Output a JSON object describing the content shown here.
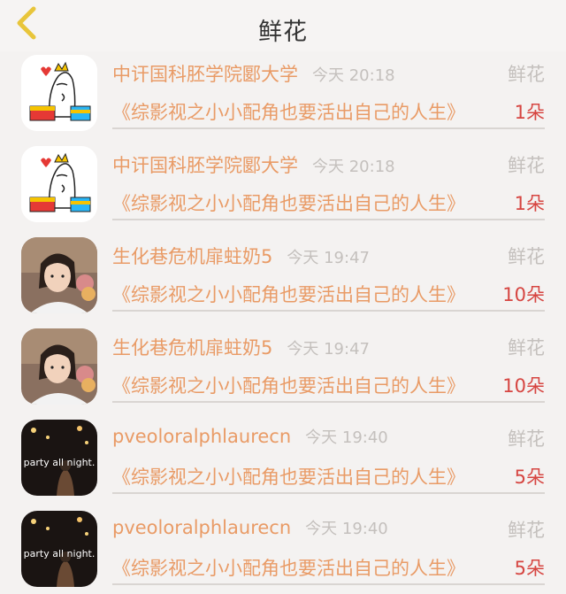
{
  "header": {
    "title": "鲜花"
  },
  "rows": [
    {
      "sender": "中讦国科胚学院郾大学",
      "time": "今天 20:18",
      "gift_type": "鲜花",
      "book": "《综影视之小小配角也要活出自己的人生》",
      "count": "1朵",
      "avatar_icon": "cartoon-character-icon"
    },
    {
      "sender": "中讦国科胚学院郾大学",
      "time": "今天 20:18",
      "gift_type": "鲜花",
      "book": "《综影视之小小配角也要活出自己的人生》",
      "count": "1朵",
      "avatar_icon": "cartoon-character-icon"
    },
    {
      "sender": "生化巷危机扉蛀奶5",
      "time": "今天 19:47",
      "gift_type": "鲜花",
      "book": "《综影视之小小配角也要活出自己的人生》",
      "count": "10朵",
      "avatar_icon": "girl-photo-icon"
    },
    {
      "sender": "生化巷危机扉蛀奶5",
      "time": "今天 19:47",
      "gift_type": "鲜花",
      "book": "《综影视之小小配角也要活出自己的人生》",
      "count": "10朵",
      "avatar_icon": "girl-photo-icon"
    },
    {
      "sender": "pveoloralphlaurecn",
      "time": "今天 19:40",
      "gift_type": "鲜花",
      "book": "《综影视之小小配角也要活出自己的人生》",
      "count": "5朵",
      "avatar_icon": "party-photo-icon",
      "avatar_text": "party all night."
    },
    {
      "sender": "pveoloralphlaurecn",
      "time": "今天 19:40",
      "gift_type": "鲜花",
      "book": "《综影视之小小配角也要活出自己的人生》",
      "count": "5朵",
      "avatar_icon": "party-photo-icon",
      "avatar_text": "party all night."
    }
  ],
  "colors": {
    "accent": "#e99b66",
    "count": "#d64541",
    "muted": "#c4c0bd",
    "back_arrow": "#e8c53a"
  }
}
